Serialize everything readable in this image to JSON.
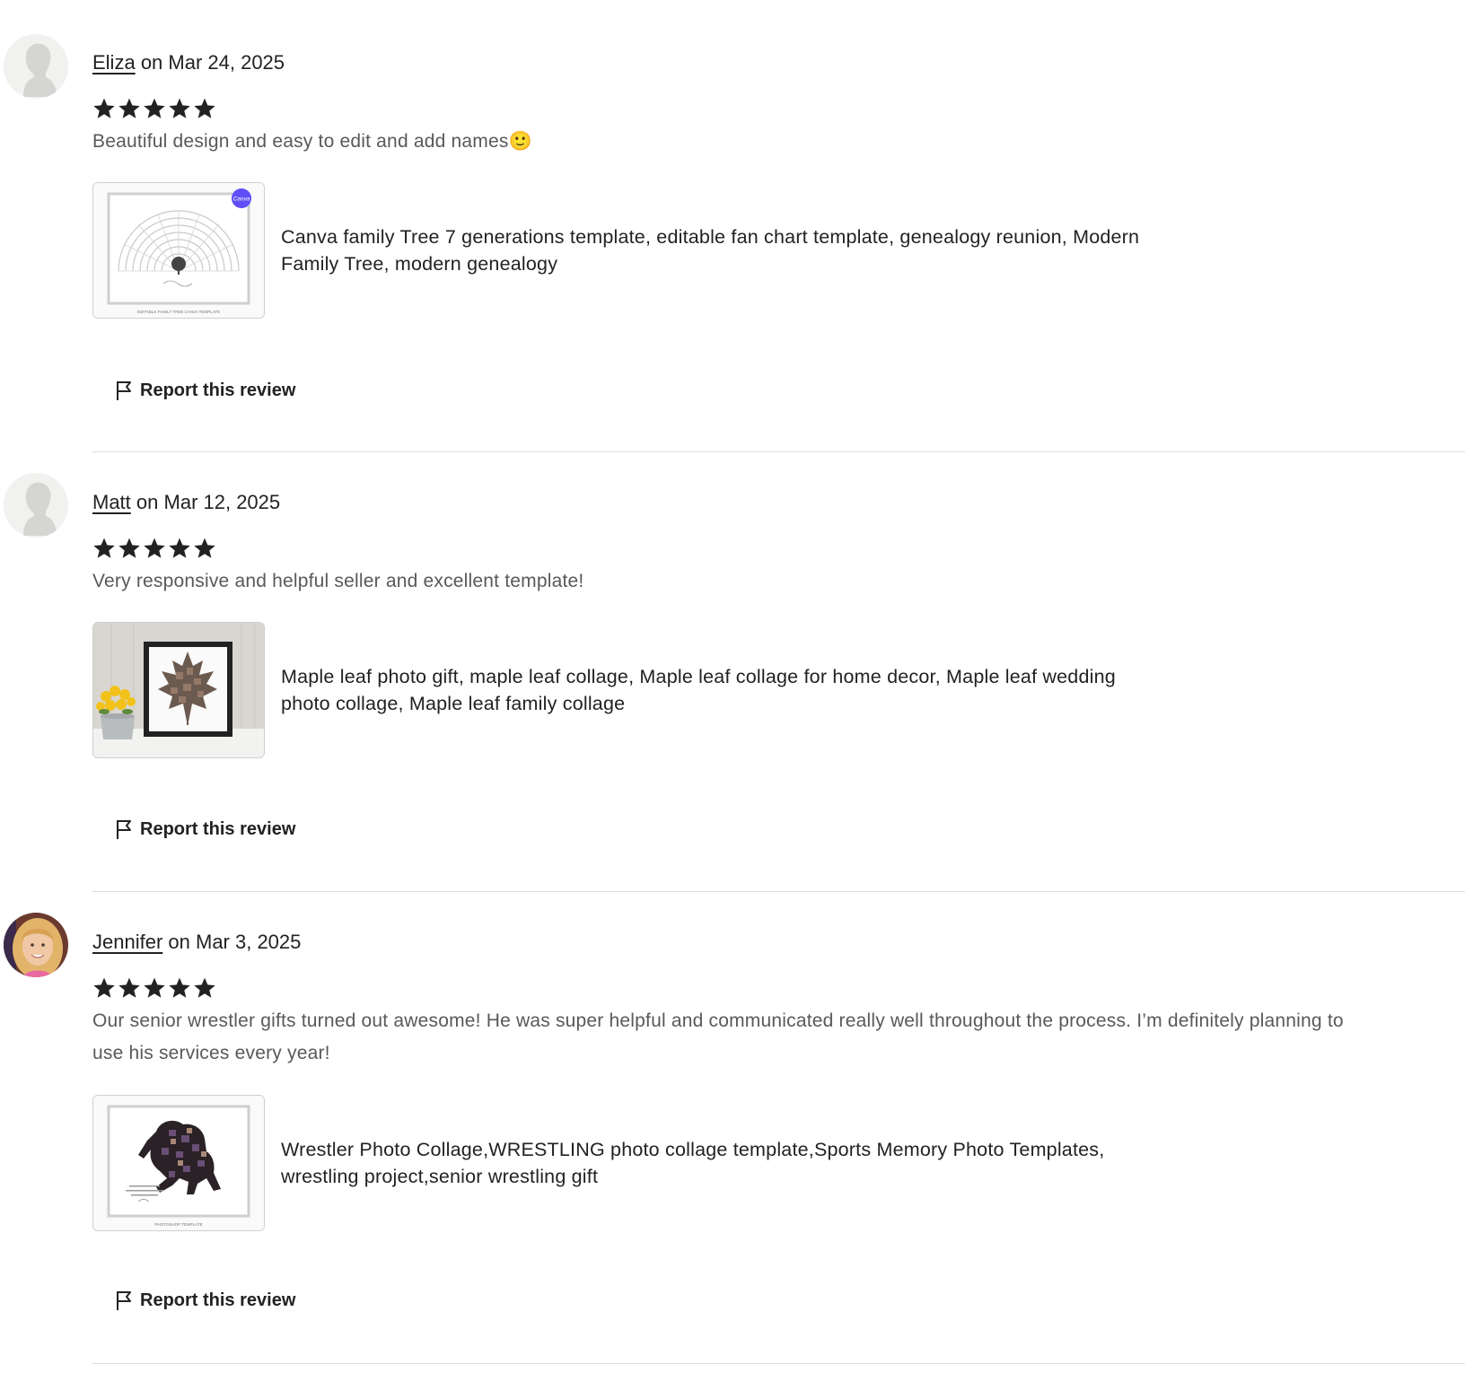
{
  "reviews": [
    {
      "reviewer": "Eliza",
      "date_text": "on Mar 24, 2025",
      "rating": 5,
      "text": "Beautiful design and easy to edit and add names🙂",
      "avatar": "default-silhouette",
      "product": {
        "title": "Canva family Tree 7 generations template, editable fan chart template, genealogy reunion, Modern Family Tree, modern genealogy",
        "thumb": "fan-chart-family-tree-image",
        "badge": "Canva",
        "footer_text": "EDITABLE FAMILY TREE CANVA TEMPLATE"
      },
      "report_label": "Report this review"
    },
    {
      "reviewer": "Matt",
      "date_text": "on Mar 12, 2025",
      "rating": 5,
      "text": "Very responsive and helpful seller and excellent template!",
      "avatar": "default-silhouette",
      "product": {
        "title": "Maple leaf photo gift, maple leaf collage, Maple leaf collage for home decor, Maple leaf wedding photo collage, Maple leaf family collage",
        "thumb": "maple-leaf-collage-image"
      },
      "report_label": "Report this review"
    },
    {
      "reviewer": "Jennifer",
      "date_text": "on Mar 3, 2025",
      "rating": 5,
      "text": "Our senior wrestler gifts turned out awesome! He was super helpful and communicated really well throughout the process. I’m definitely planning to use his services every year!",
      "avatar": "user-photo",
      "product": {
        "title": "Wrestler Photo Collage,WRESTLING photo collage template,Sports Memory Photo Templates, wrestling project,senior wrestling gift",
        "thumb": "wrestler-collage-image",
        "footer_text": "PHOTOSHOP TEMPLATE"
      },
      "report_label": "Report this review"
    }
  ],
  "colors": {
    "text": "#222222",
    "muted": "#595959",
    "divider": "#dedede",
    "star": "#222222"
  }
}
